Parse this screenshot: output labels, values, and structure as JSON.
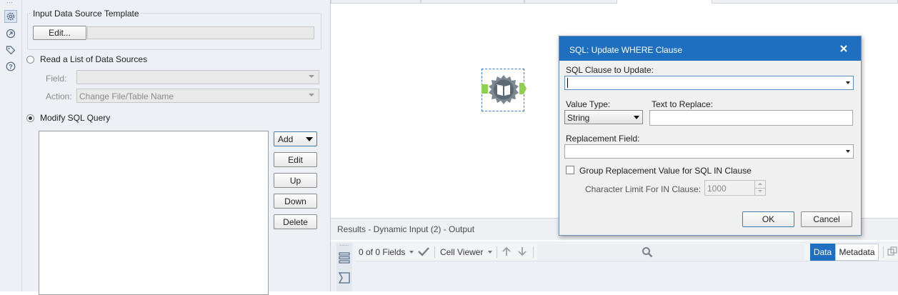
{
  "left_panel": {
    "template_group": {
      "title": "Input Data Source Template",
      "edit_label": "Edit..."
    },
    "read_list": {
      "label": "Read a List of Data Sources",
      "field_label": "Field:",
      "field_value": "",
      "action_label": "Action:",
      "action_value": "Change File/Table Name"
    },
    "modify_sql": {
      "label": "Modify SQL Query",
      "buttons": {
        "add": "Add",
        "edit": "Edit",
        "up": "Up",
        "down": "Down",
        "delete": "Delete"
      }
    }
  },
  "results": {
    "header": "Results - Dynamic Input (2) - Output",
    "fields_count": "0 of 0 Fields",
    "cell_viewer": "Cell Viewer",
    "data_tab": "Data",
    "metadata_tab": "Metadata"
  },
  "dialog": {
    "title": "SQL: Update WHERE Clause",
    "clause_label": "SQL Clause to Update:",
    "clause_value": "",
    "value_type_label": "Value Type:",
    "value_type_value": "String",
    "text_to_replace_label": "Text to Replace:",
    "text_to_replace_value": "",
    "replacement_field_label": "Replacement Field:",
    "replacement_field_value": "",
    "group_label": "Group Replacement Value for SQL IN Clause",
    "char_limit_label": "Character Limit For IN Clause:",
    "char_limit_value": "1000",
    "ok_label": "OK",
    "cancel_label": "Cancel"
  },
  "colors": {
    "dialog_title_bg": "#1f6fc0",
    "accent_blue": "#1f6fc0",
    "node_connector": "#8fd14f"
  }
}
